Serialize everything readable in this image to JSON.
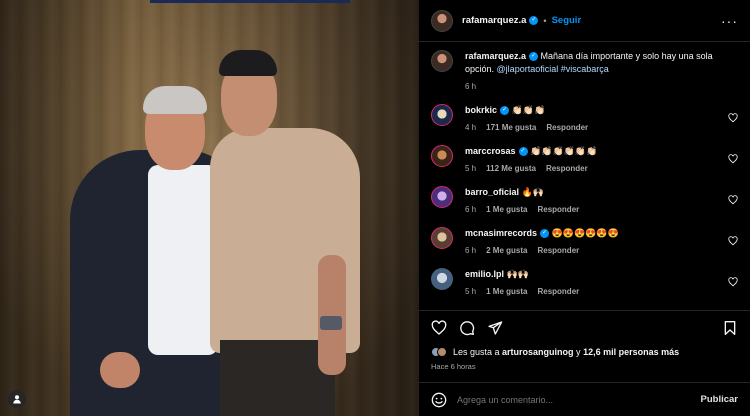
{
  "header": {
    "username": "rafamarquez.a",
    "separator": "•",
    "follow_label": "Seguir",
    "more_icon": "more-horizontal-icon"
  },
  "caption": {
    "username": "rafamarquez.a",
    "text": "Mañana día importante y solo hay una sola opción.",
    "mention": "@jlaportaoficial",
    "hashtag": "#viscabarça",
    "time": "6 h"
  },
  "comments": [
    {
      "username": "bokrkic",
      "verified": true,
      "text": "👏🏻👏🏻👏🏻",
      "time": "4 h",
      "likes": "171 Me gusta",
      "reply": "Responder"
    },
    {
      "username": "marccrosas",
      "verified": true,
      "text": "👏🏻👏🏻👏🏻👏🏻👏🏻👏🏻",
      "time": "5 h",
      "likes": "112 Me gusta",
      "reply": "Responder"
    },
    {
      "username": "barro_oficial",
      "verified": false,
      "text": "🔥🙌🏻",
      "time": "6 h",
      "likes": "1 Me gusta",
      "reply": "Responder"
    },
    {
      "username": "mcnasimrecords",
      "verified": true,
      "text": "😍😍😍😍😍😍",
      "time": "6 h",
      "likes": "2 Me gusta",
      "reply": "Responder"
    },
    {
      "username": "emilio.lpl",
      "verified": false,
      "text": "🙌🏻🙌🏻",
      "time": "5 h",
      "likes": "1 Me gusta",
      "reply": "Responder"
    }
  ],
  "likes_summary": {
    "prefix": "Les gusta a ",
    "user": "arturosanguinog",
    "middle": " y ",
    "count": "12,6 mil personas más"
  },
  "posted_ago": "Hace 6 horas",
  "add_comment": {
    "placeholder": "Agrega un comentario...",
    "publish_label": "Publicar"
  },
  "colors": {
    "accent": "#0095f6",
    "background": "#000000",
    "secondary_text": "#a8a8a8"
  }
}
